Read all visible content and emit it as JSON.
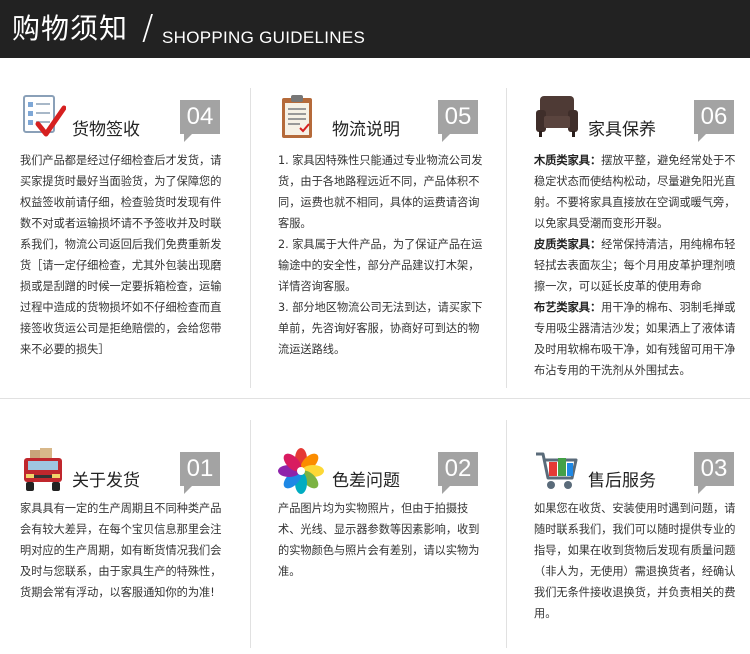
{
  "header": {
    "title_cn": "购物须知",
    "slash": "/",
    "title_en": "SHOPPING GUIDELINES"
  },
  "cards": {
    "receipt": {
      "title": "货物签收",
      "number": "04",
      "icon": "checklist-icon",
      "body": "我们产品都是经过仔细检查后才发货，请买家提货时最好当面验货，为了保障您的权益签收前请仔细，检查验货时发现有件数不对或者运输损坏请不予签收并及时联系我们，物流公司返回后我们免费重新发货［请一定仔细检查，尤其外包装出现磨损或是刮蹭的时候一定要拆箱检查，运输过程中造成的货物损坏如不仔细检查而直接签收货运公司是拒绝赔偿的，会给您带来不必要的损失］"
    },
    "logistics": {
      "title": "物流说明",
      "number": "05",
      "icon": "clipboard-icon",
      "items": [
        "1. 家具因特殊性只能通过专业物流公司发货，由于各地路程远近不同，产品体积不同，运费也就不相同，具体的运费请咨询客服。",
        "2. 家具属于大件产品，为了保证产品在运输途中的安全性，部分产品建议打木架，详情咨询客服。",
        "3. 部分地区物流公司无法到达，请买家下单前，先咨询好客服，协商好可到达的物流运送路线。"
      ]
    },
    "care": {
      "title": "家具保养",
      "number": "06",
      "icon": "armchair-icon",
      "items": [
        {
          "label": "木质类家具：",
          "text": "摆放平整，避免经常处于不稳定状态而使结构松动，尽量避免阳光直射。不要将家具直接放在空调或暖气旁，以免家具受潮而变形开裂。"
        },
        {
          "label": "皮质类家具：",
          "text": "经常保持清洁，用纯棉布轻轻拭去表面灰尘；每个月用皮革护理剂喷擦一次，可以延长皮革的使用寿命"
        },
        {
          "label": "布艺类家具：",
          "text": "用干净的棉布、羽制毛掸或专用吸尘器清洁沙发；如果洒上了液体请及时用软棉布吸干净，如有残留可用干净布沾专用的干洗剂从外围拭去。"
        }
      ]
    },
    "shipping": {
      "title": "关于发货",
      "number": "01",
      "icon": "truck-icon",
      "body": "家具具有一定的生产周期且不同种类产品会有较大差异，在每个宝贝信息那里会注明对应的生产周期，如有断货情况我们会及时与您联系，由于家具生产的特殊性，货期会常有浮动，以客服通知你的为准!"
    },
    "color": {
      "title": "色差问题",
      "number": "02",
      "icon": "color-petals-icon",
      "body": "产品图片均为实物照片，但由于拍摄技术、光线、显示器参数等因素影响，收到的实物颜色与照片会有差别，请以实物为准。"
    },
    "aftersales": {
      "title": "售后服务",
      "number": "03",
      "icon": "cart-icon",
      "body": "如果您在收货、安装使用时遇到问题，请随时联系我们，我们可以随时提供专业的指导，如果在收到货物后发现有质量问题（非人为，无使用）需退换货者，经确认我们无条件接收退换货，并负责相关的费用。"
    }
  }
}
